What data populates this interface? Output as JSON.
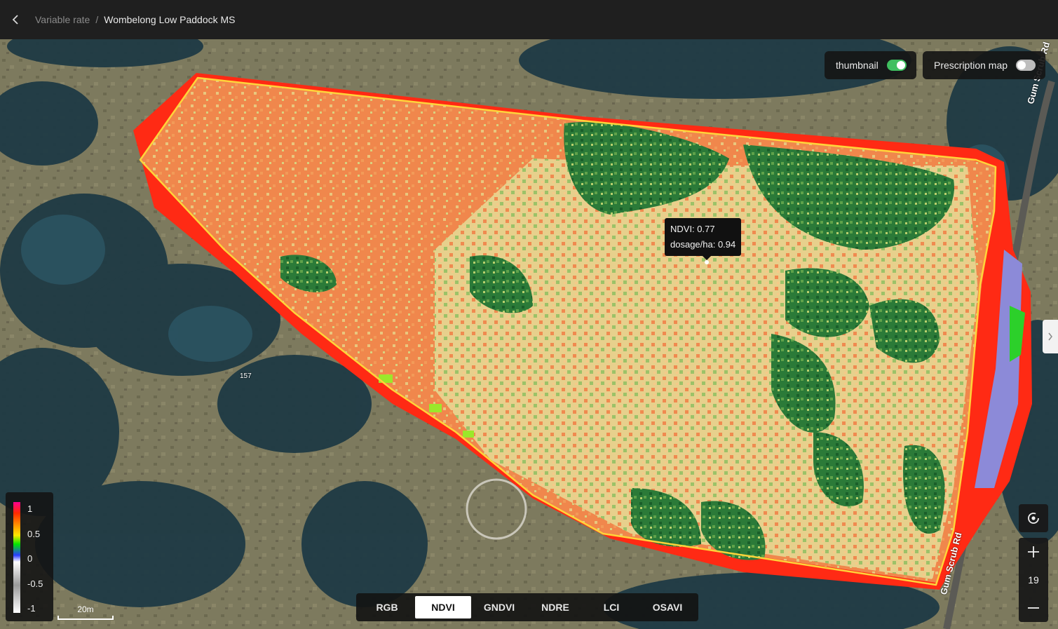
{
  "header": {
    "back_icon": "chevron-left-icon",
    "breadcrumb_parent": "Variable rate",
    "breadcrumb_separator": "/",
    "breadcrumb_current": "Wombelong Low Paddock MS"
  },
  "toggles": {
    "thumbnail_label": "thumbnail",
    "thumbnail_on": true,
    "prescription_label": "Prescription map",
    "prescription_on": false
  },
  "tooltip": {
    "ndvi_line": "NDVI: 0.77",
    "dosage_line": "dosage/ha: 0.94"
  },
  "map_labels": {
    "road_top": "Gum Scrub Rd",
    "road_bottom": "Gum Scrub Rd",
    "parcel_number": "157"
  },
  "legend": {
    "ticks": [
      "1",
      "0.5",
      "0",
      "-0.5",
      "-1"
    ]
  },
  "scale": {
    "label": "20m"
  },
  "index_tabs": {
    "items": [
      "RGB",
      "NDVI",
      "GNDVI",
      "NDRE",
      "LCI",
      "OSAVI"
    ],
    "active": "NDVI"
  },
  "controls": {
    "recenter_icon": "recenter-icon",
    "zoom_in_icon": "plus-icon",
    "zoom_level": "19",
    "zoom_out_icon": "minus-icon",
    "expand_icon": "chevron-right-icon"
  },
  "colors": {
    "accent_on": "#3fbf5f",
    "field_orange": "#f08a4f",
    "field_green": "#1f6e33",
    "field_red": "#ff2a00",
    "boundary": "#ffd43a"
  }
}
